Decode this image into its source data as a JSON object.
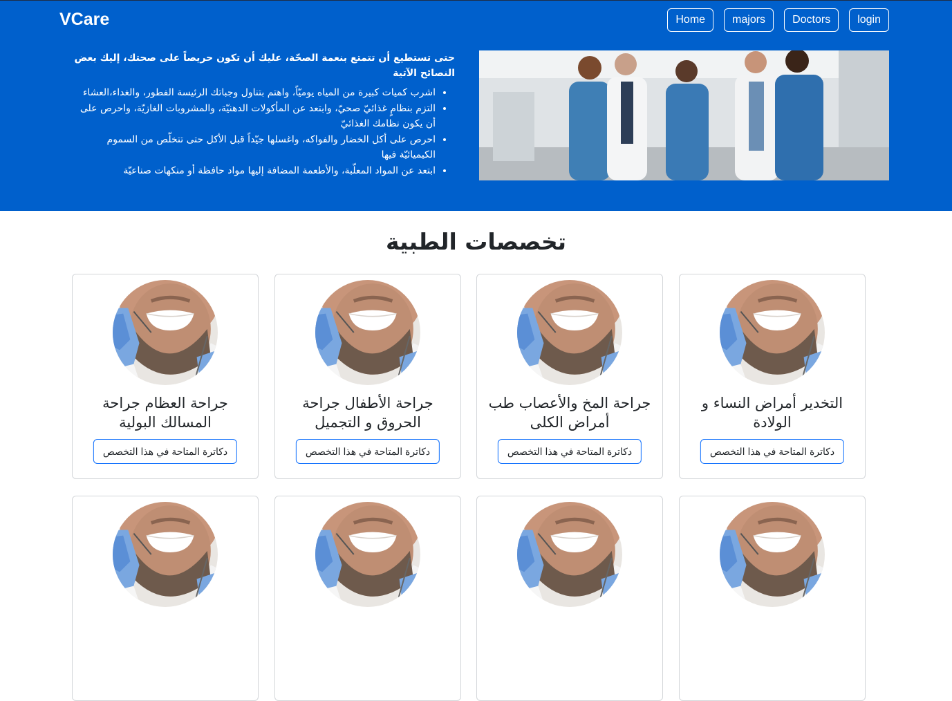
{
  "brand": "VCare",
  "nav": {
    "home": "Home",
    "majors": "majors",
    "doctors": "Doctors",
    "login": "login"
  },
  "tips": {
    "title": "حتى تستطيع أن تتمتع بنعمة الصحّة، عليك أن تكون حريصاً على صحتك، إليك بعض النصائح الآتية",
    "items": [
      "اشرب كميات كبيرة من المياه يوميّاً، واهتم بتناول وجباتك الرئيسة الفطور، والغداء،العشاء",
      "التزم بنظامٍ غذائيّ صحيّ، وابتعد عن المأكولات الدهنيّة، والمشروبات الغازيّة، واحرص على أن يكون نظامك الغذائيّ",
      "احرص على أكل الخضار والفواكه، واغسلها جيّداً قبل الأكل حتى تتخلّص من السموم الكيميائيّة فيها",
      "ابتعد عن المواد المعلّبة، والأطعمة المضافة إليها مواد حافظة أو منكهات صناعيّة"
    ]
  },
  "hero_image": "doctors-group-photo",
  "section_title": "تخصصات الطبية",
  "card_button": "دكاترة المتاحة في هذا التخصص",
  "cards": [
    {
      "title": "التخدير أمراض النساء و الولادة"
    },
    {
      "title": "جراحة المخ والأعصاب طب أمراض الكلى"
    },
    {
      "title": "جراحة الأطفال جراحة الحروق و التجميل"
    },
    {
      "title": "جراحة العظام جراحة المسالك البولية"
    },
    {
      "title": ""
    },
    {
      "title": ""
    },
    {
      "title": ""
    },
    {
      "title": ""
    }
  ],
  "colors": {
    "hero_bg": "#0060CC",
    "button_border": "#0d6efd"
  }
}
